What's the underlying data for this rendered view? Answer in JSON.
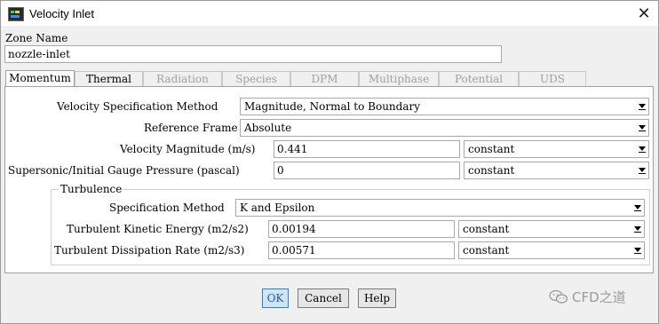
{
  "window": {
    "title": "Velocity Inlet"
  },
  "zone": {
    "label": "Zone Name",
    "value": "nozzle-inlet"
  },
  "tabs": [
    {
      "label": "Momentum",
      "state": "active"
    },
    {
      "label": "Thermal",
      "state": "enabled"
    },
    {
      "label": "Radiation",
      "state": "disabled"
    },
    {
      "label": "Species",
      "state": "disabled"
    },
    {
      "label": "DPM",
      "state": "disabled"
    },
    {
      "label": "Multiphase",
      "state": "disabled"
    },
    {
      "label": "Potential",
      "state": "disabled"
    },
    {
      "label": "UDS",
      "state": "disabled"
    }
  ],
  "momentum": {
    "velocity_spec": {
      "label": "Velocity Specification Method",
      "value": "Magnitude, Normal to Boundary"
    },
    "reference_frame": {
      "label": "Reference Frame",
      "value": "Absolute"
    },
    "velocity_magnitude": {
      "label": "Velocity Magnitude (m/s)",
      "value": "0.441",
      "profile": "constant"
    },
    "gauge_pressure": {
      "label": "Supersonic/Initial Gauge Pressure (pascal)",
      "value": "0",
      "profile": "constant"
    }
  },
  "turbulence": {
    "title": "Turbulence",
    "spec_method": {
      "label": "Specification Method",
      "value": "K and Epsilon"
    },
    "kinetic_energy": {
      "label": "Turbulent Kinetic Energy (m2/s2)",
      "value": "0.00194",
      "profile": "constant"
    },
    "dissipation_rate": {
      "label": "Turbulent Dissipation Rate (m2/s3)",
      "value": "0.00571",
      "profile": "constant"
    }
  },
  "buttons": {
    "ok": "OK",
    "cancel": "Cancel",
    "help": "Help"
  },
  "watermark": {
    "text": "CFD之道"
  }
}
